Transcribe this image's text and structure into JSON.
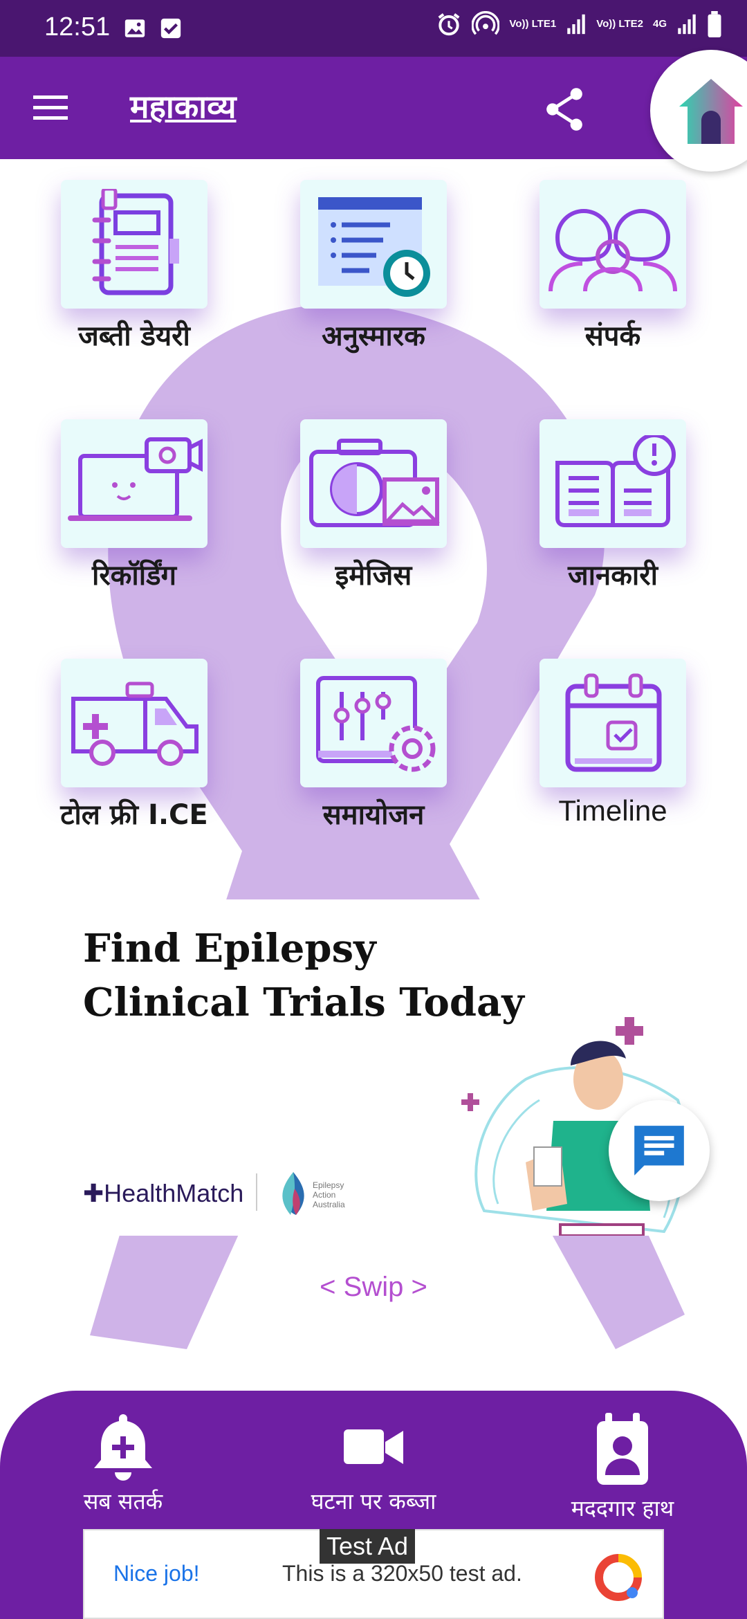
{
  "status_bar": {
    "time": "12:51",
    "net1": "Vo)) LTE1",
    "net2": "Vo)) LTE2",
    "net3": "4G"
  },
  "app_bar": {
    "title": "महाकाव्य"
  },
  "tiles": [
    {
      "label": "जब्ती डेयरी",
      "icon": "diary-icon"
    },
    {
      "label": "अनुस्मारक",
      "icon": "reminder-icon"
    },
    {
      "label": "संपर्क",
      "icon": "contacts-icon"
    },
    {
      "label": "रिकॉर्डिंग",
      "icon": "recording-icon"
    },
    {
      "label": "इमेजिस",
      "icon": "images-icon"
    },
    {
      "label": "जानकारी",
      "icon": "info-book-icon"
    },
    {
      "label": "टोल फ्री I.CE",
      "icon": "ambulance-icon"
    },
    {
      "label": "समायोजन",
      "icon": "settings-sliders-icon"
    },
    {
      "label": "Timeline",
      "icon": "calendar-icon"
    }
  ],
  "banner": {
    "title_line1": "Find Epilepsy",
    "title_line2": "Clinical Trials Today",
    "logo1": "HealthMatch",
    "logo2_line1": "Epilepsy",
    "logo2_line2": "Action",
    "logo2_line3": "Australia"
  },
  "swip": "< Swip >",
  "bottom_nav": [
    {
      "label": "सब सतर्क",
      "icon": "bell-plus-icon"
    },
    {
      "label": "घटना पर कब्जा",
      "icon": "video-camera-icon"
    },
    {
      "label": "मददगार हाथ",
      "icon": "contact-badge-icon"
    }
  ],
  "ad": {
    "label": "Test Ad",
    "nice": "Nice job!",
    "text": "This is a 320x50 test ad."
  },
  "colors": {
    "status_bar": "#4a1670",
    "primary": "#6e1fa3",
    "accent": "#e040fb",
    "tile_bg": "#e8fbfb"
  }
}
